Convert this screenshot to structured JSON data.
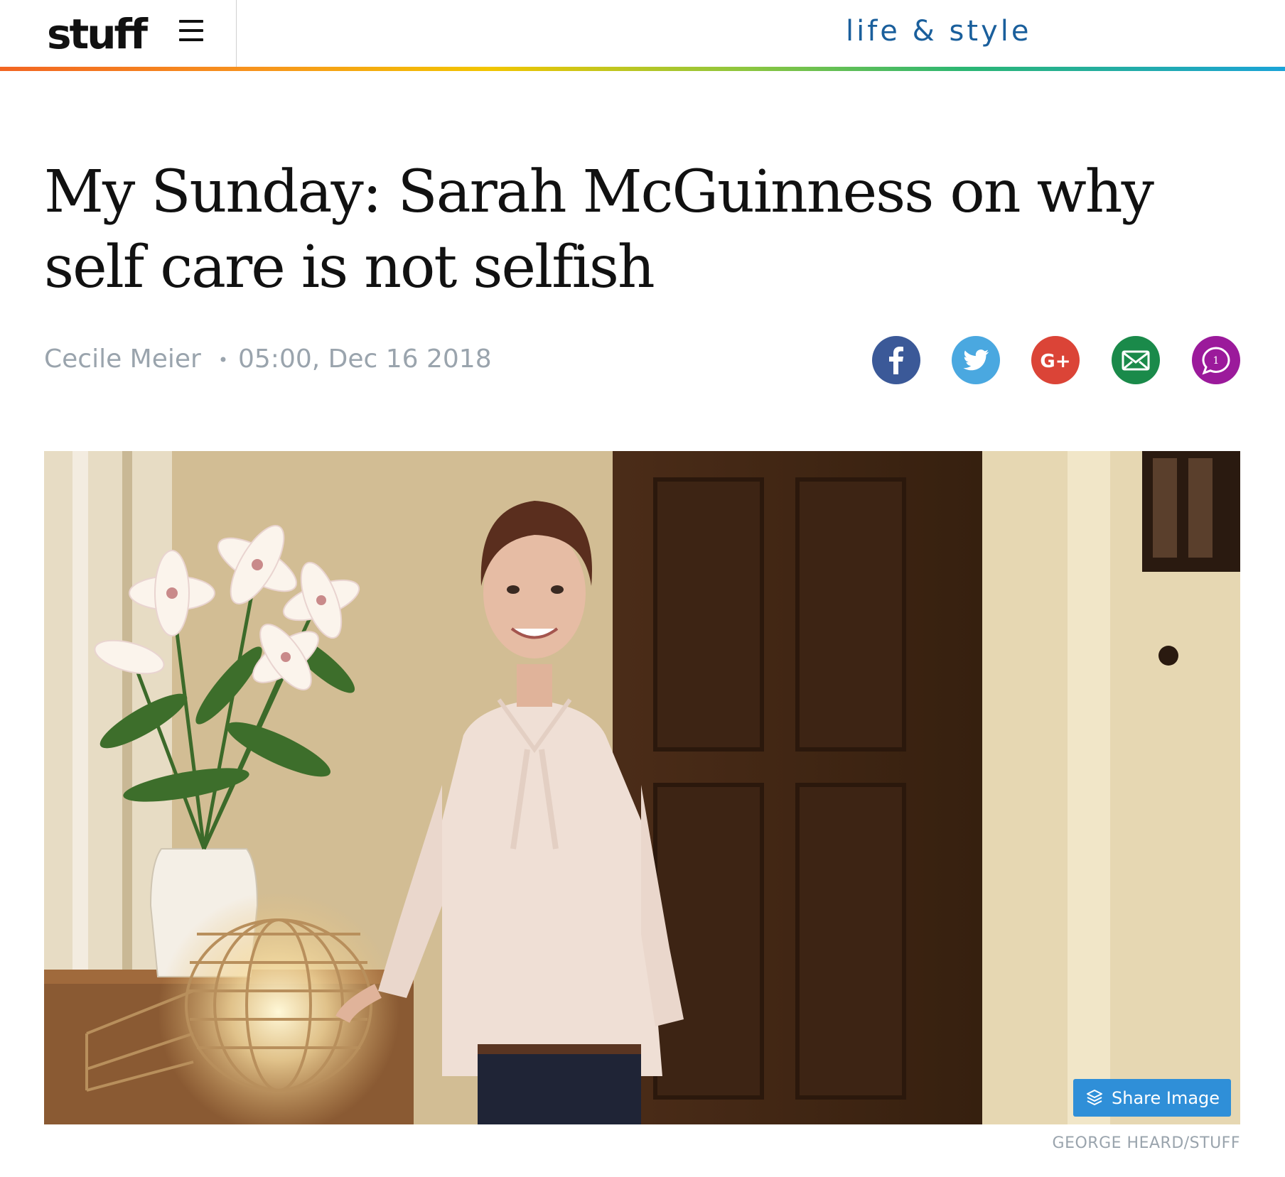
{
  "header": {
    "logo": "stuff",
    "section": "life & style"
  },
  "article": {
    "headline": "My Sunday: Sarah McGuinness on why self care is not selfish",
    "author": "Cecile Meier",
    "separator": "•",
    "timestamp": "05:00, Dec 16 2018"
  },
  "share": {
    "icons": [
      "facebook-icon",
      "twitter-icon",
      "google-plus-icon",
      "email-icon",
      "comments-icon"
    ],
    "colors": {
      "facebook": "#3b5998",
      "twitter": "#4aa8e0",
      "google_plus": "#db4437",
      "email": "#1a8a4a",
      "comments": "#9b1a9b"
    },
    "comment_count": "1",
    "google_plus_text": "G+"
  },
  "hero": {
    "share_button_label": "Share Image",
    "credit": "GEORGE HEARD/STUFF"
  },
  "colors": {
    "section_title": "#1a5f9c",
    "byline": "#9aa4ad",
    "share_button": "#2f8fd8"
  }
}
